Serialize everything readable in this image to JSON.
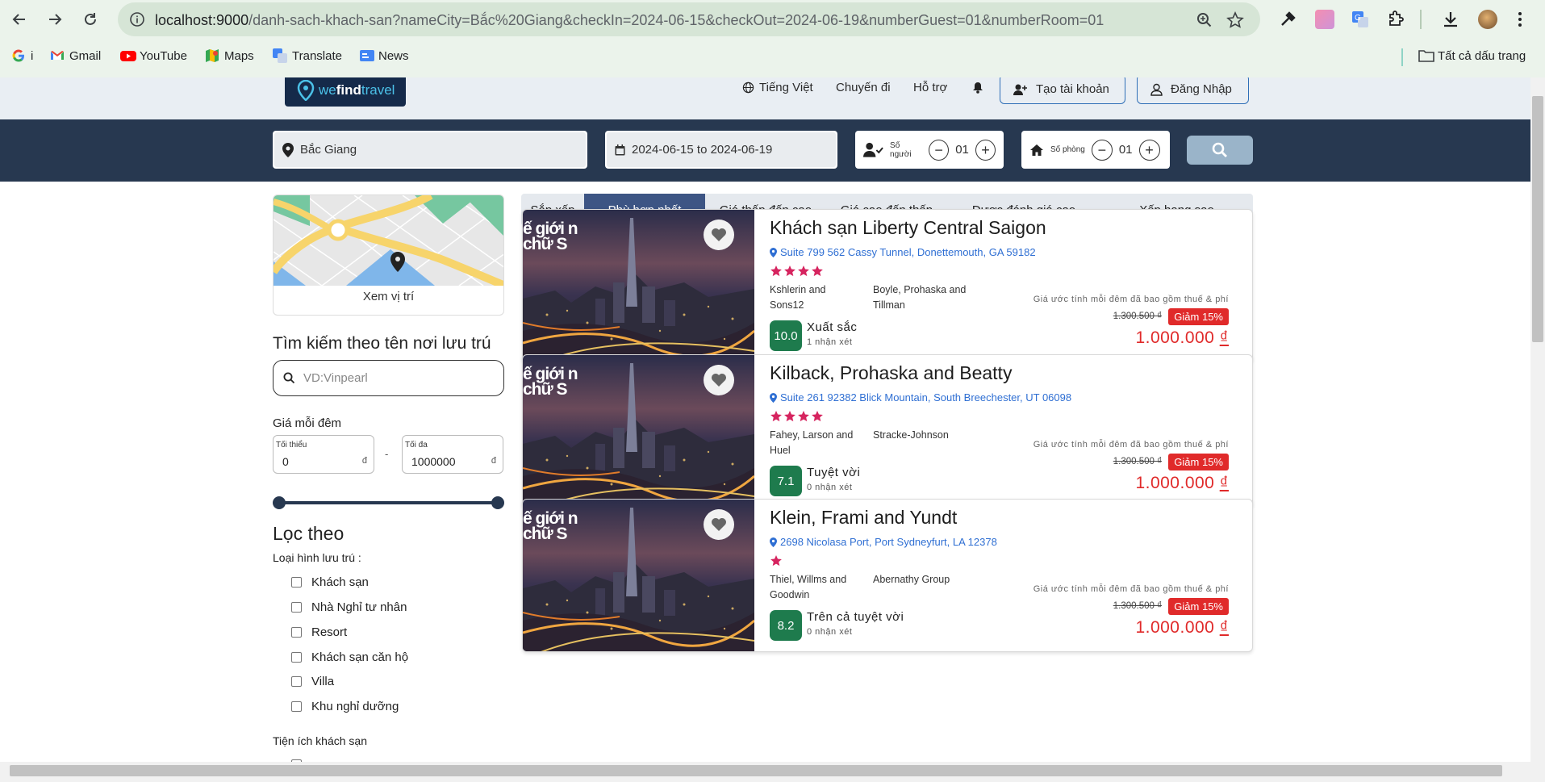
{
  "browser": {
    "url_host": "localhost:9000",
    "url_rest": "/danh-sach-khach-san?nameCity=Bắc%20Giang&checkIn=2024-06-15&checkOut=2024-06-19&numberGuest=01&numberRoom=01",
    "bookmarks": [
      {
        "label": "i",
        "icon": "google-icon"
      },
      {
        "label": "Gmail",
        "icon": "gmail-icon"
      },
      {
        "label": "YouTube",
        "icon": "youtube-icon"
      },
      {
        "label": "Maps",
        "icon": "maps-icon"
      },
      {
        "label": "Translate",
        "icon": "translate-icon"
      },
      {
        "label": "News",
        "icon": "news-icon"
      }
    ],
    "all_bookmarks": "Tất cả dấu trang"
  },
  "header": {
    "logo_prefix": "we",
    "logo_bold": "find",
    "logo_suffix": "travel",
    "language": "Tiếng Việt",
    "trips": "Chuyến đi",
    "support": "Hỗ trợ",
    "register": "Tạo tài khoản",
    "login": "Đăng Nhập"
  },
  "search": {
    "city": "Bắc Giang",
    "dates": "2024-06-15 to 2024-06-19",
    "guests_label": "Số người",
    "guests_value": "01",
    "rooms_label": "Số phòng",
    "rooms_value": "01"
  },
  "sidebar": {
    "map_caption": "Xem vị trí",
    "search_title": "Tìm kiếm theo tên nơi lưu trú",
    "search_placeholder": "VD:Vinpearl",
    "price_title": "Giá mỗi đêm",
    "min_label": "Tối thiểu",
    "min_value": "0",
    "max_label": "Tối đa",
    "max_value": "1000000",
    "currency": "đ",
    "dash": "-",
    "filter_title": "Lọc theo",
    "type_title": "Loại hình lưu trú :",
    "types": [
      "Khách sạn",
      "Nhà Nghỉ tư nhân",
      "Resort",
      "Khách sạn căn hộ",
      "Villa",
      "Khu nghỉ dưỡng"
    ],
    "amenities_title": "Tiện ích khách sạn"
  },
  "sort": {
    "label": "Sắp xếp",
    "options": [
      "Phù hợp nhất",
      "Giá thấp đến cao",
      "Giá cao đến thấp",
      "Được đánh giá cao",
      "Xếp hạng sao"
    ],
    "active": "Phù hợp nhất"
  },
  "hotels": [
    {
      "name": "Khách sạn Liberty Central Saigon",
      "address": "Suite 799 562 Cassy Tunnel, Donettemouth, GA 59182",
      "stars": 4,
      "tags": [
        "Kshlerin and Sons12",
        "Boyle, Prohaska and Tillman"
      ],
      "score": "10.0",
      "rating_word": "Xuất sắc",
      "reviews": "1 nhận xét",
      "tax_note": "Giá ước tính mỗi đêm đã bao gồm thuế & phí",
      "old_price": "1.300.500 ₫",
      "discount": "Giảm 15%",
      "price": "1.000.000",
      "price_unit": "₫",
      "image_caption": "ế giới n chữ S"
    },
    {
      "name": "Kilback, Prohaska and Beatty",
      "address": "Suite 261 92382 Blick Mountain, South Breechester, UT 06098",
      "stars": 4,
      "tags": [
        "Fahey, Larson and Huel",
        "Stracke-Johnson"
      ],
      "score": "7.1",
      "rating_word": "Tuyệt vời",
      "reviews": "0 nhận xét",
      "tax_note": "Giá ước tính mỗi đêm đã bao gồm thuế & phí",
      "old_price": "1.300.500 ₫",
      "discount": "Giảm 15%",
      "price": "1.000.000",
      "price_unit": "₫",
      "image_caption": "ế giới n chữ S"
    },
    {
      "name": "Klein, Frami and Yundt",
      "address": "2698 Nicolasa Port, Port Sydneyfurt, LA 12378",
      "stars": 1,
      "tags": [
        "Thiel, Willms and Goodwin",
        "Abernathy Group"
      ],
      "score": "8.2",
      "rating_word": "Trên cả tuyệt vời",
      "reviews": "0 nhận xét",
      "tax_note": "Giá ước tính mỗi đêm đã bao gồm thuế & phí",
      "old_price": "1.300.500 ₫",
      "discount": "Giảm 15%",
      "price": "1.000.000",
      "price_unit": "₫",
      "image_caption": "ế giới n chữ S"
    }
  ],
  "colors": {
    "navy": "#273850",
    "sort_active": "#3d5584",
    "score_green": "#1e7b4d",
    "price_red": "#e02a2a",
    "star_pink": "#d6245f",
    "link_blue": "#2f6fd3"
  }
}
